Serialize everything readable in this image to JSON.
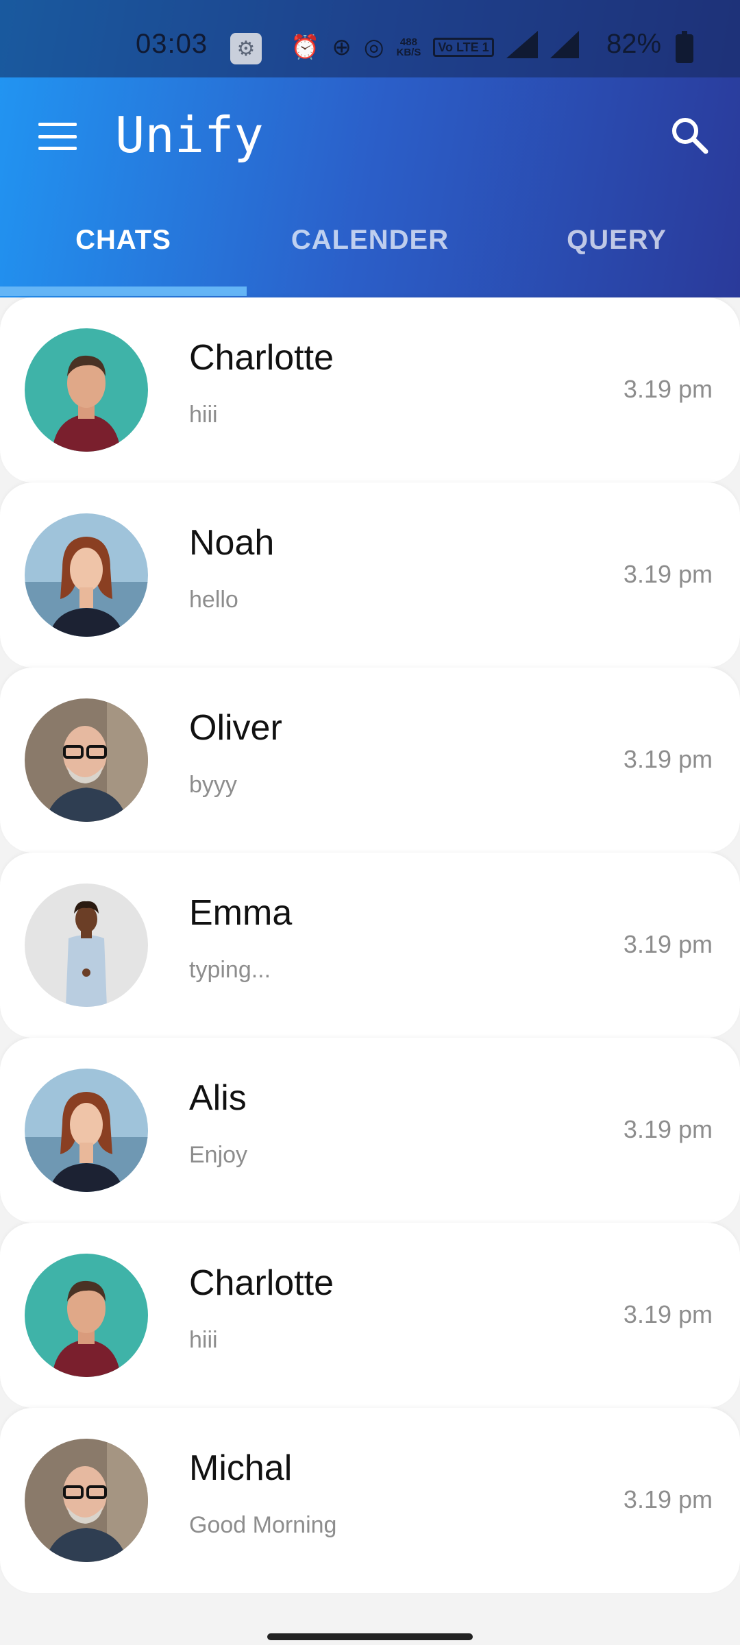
{
  "status_bar": {
    "time": "03:03",
    "speed_top": "488",
    "speed_bottom": "KB/S",
    "volte": "Vo LTE 1",
    "network": "4G",
    "battery": "82%"
  },
  "app_bar": {
    "title": "Unify",
    "menu_icon": "hamburger-menu-icon",
    "search_icon": "search-icon"
  },
  "tabs": [
    {
      "label": "CHATS",
      "active": true
    },
    {
      "label": "CALENDER",
      "active": false
    },
    {
      "label": "QUERY",
      "active": false
    }
  ],
  "colors": {
    "header_start": "#2196f3",
    "header_end": "#2a3a9a",
    "tab_indicator": "#64b5f6"
  },
  "chats": [
    {
      "name": "Charlotte",
      "message": "hiii",
      "time": "3.19 pm",
      "avatar": "man-teal"
    },
    {
      "name": "Noah",
      "message": "hello",
      "time": "3.19 pm",
      "avatar": "woman-lake"
    },
    {
      "name": "Oliver",
      "message": "byyy",
      "time": "3.19 pm",
      "avatar": "bald-man-glasses"
    },
    {
      "name": "Emma",
      "message": "typing...",
      "time": "3.19 pm",
      "avatar": "man-grey"
    },
    {
      "name": "Alis",
      "message": "Enjoy",
      "time": "3.19 pm",
      "avatar": "woman-lake"
    },
    {
      "name": "Charlotte",
      "message": "hiii",
      "time": "3.19 pm",
      "avatar": "man-teal"
    },
    {
      "name": "Michal",
      "message": "Good Morning",
      "time": "3.19 pm",
      "avatar": "bald-man-glasses"
    }
  ]
}
